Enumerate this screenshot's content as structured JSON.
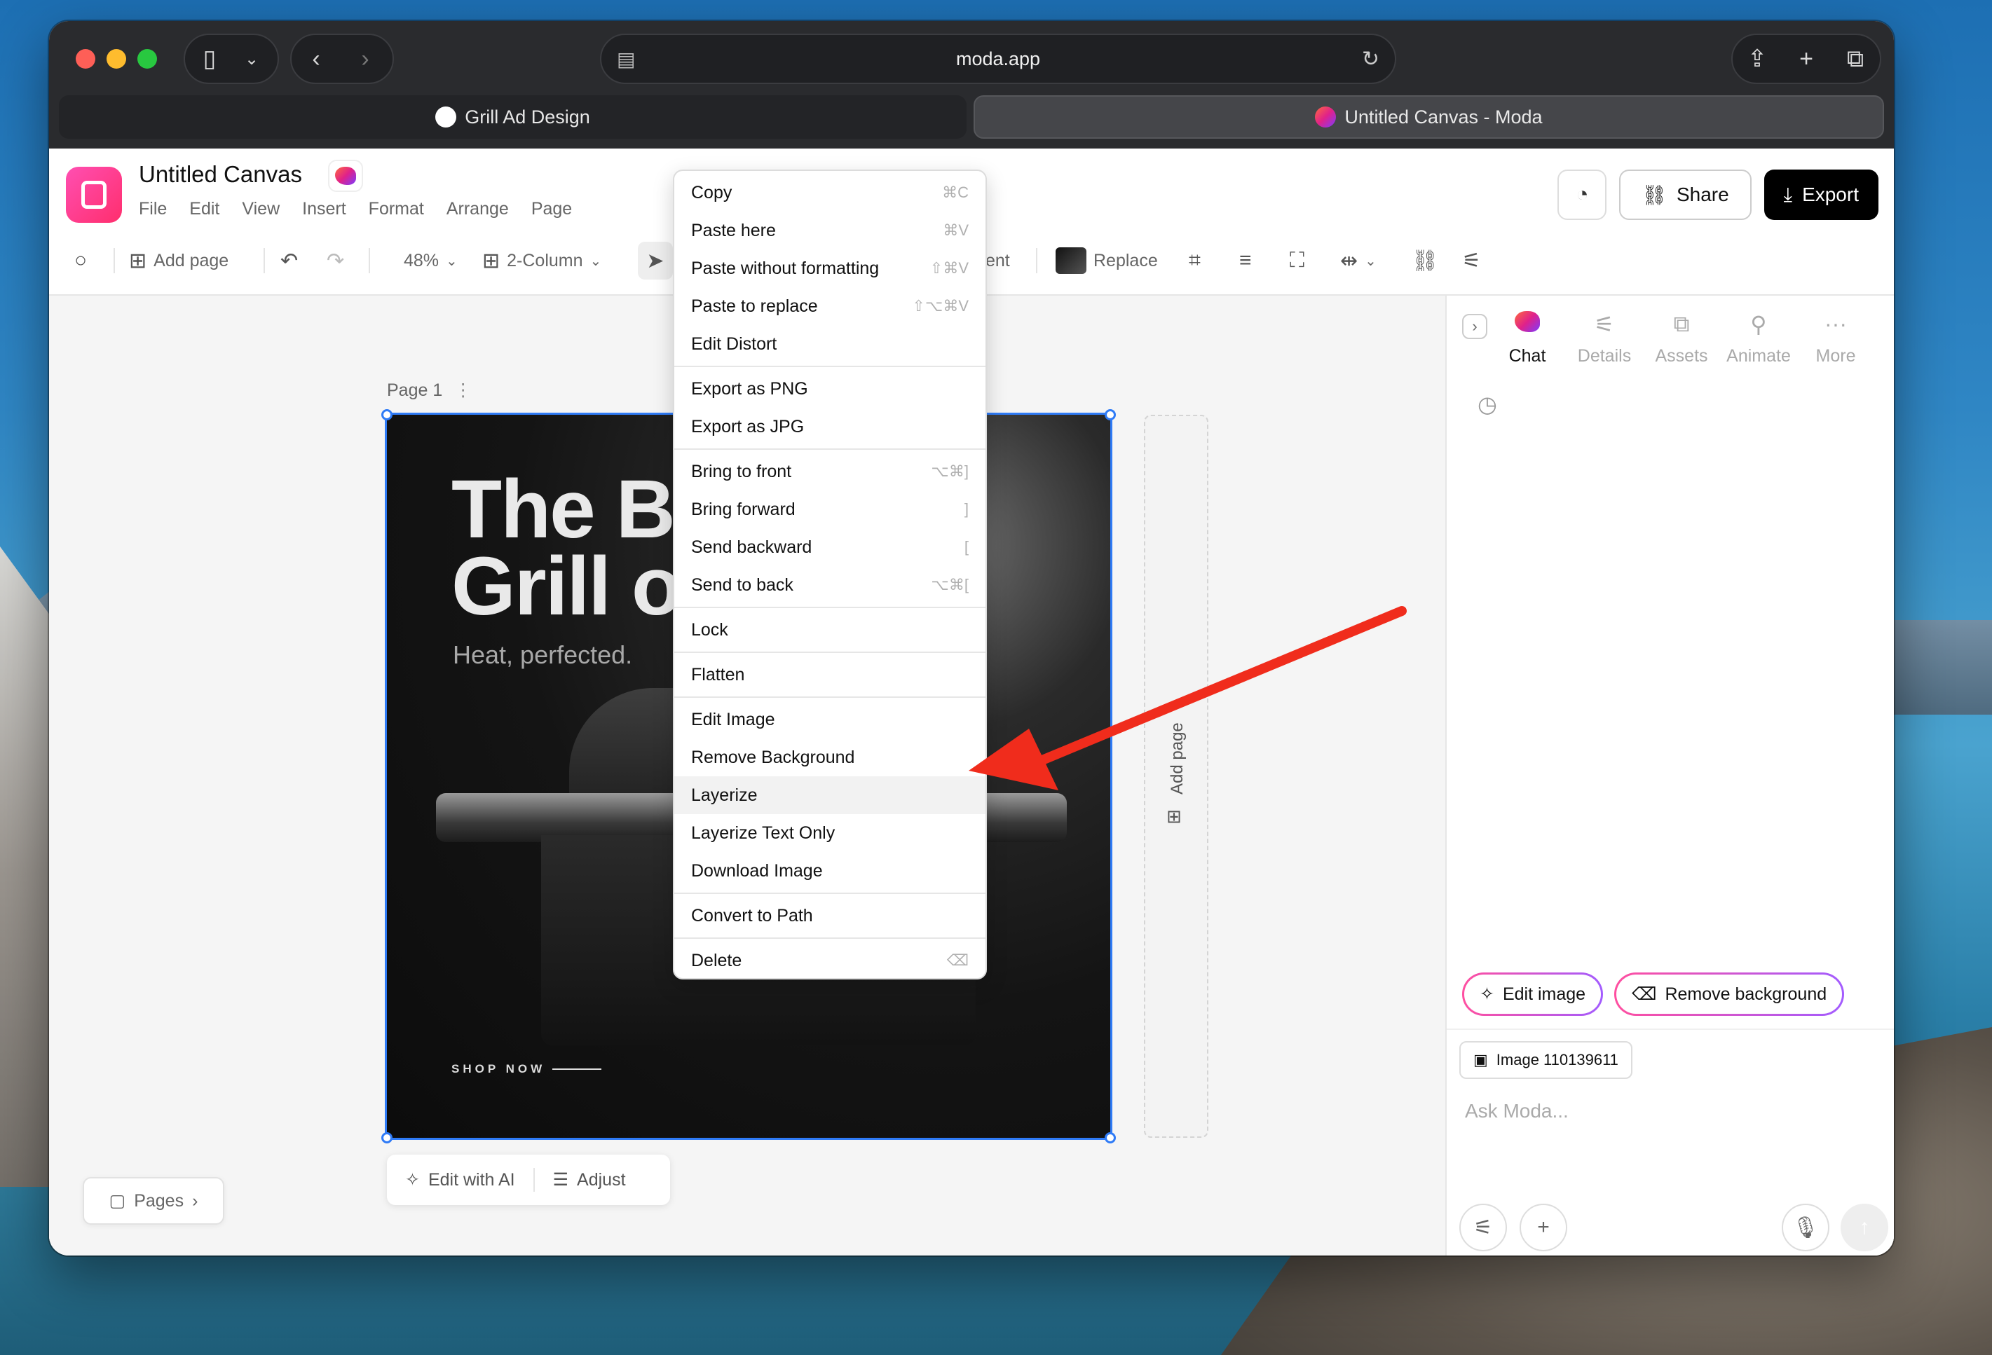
{
  "browser": {
    "url": "moda.app",
    "tabs": [
      {
        "label": "Grill Ad Design",
        "active": false
      },
      {
        "label": "Untitled Canvas - Moda",
        "active": true
      }
    ]
  },
  "app": {
    "doc_title": "Untitled Canvas",
    "menu": [
      "File",
      "Edit",
      "View",
      "Insert",
      "Format",
      "Arrange",
      "Page"
    ],
    "share_label": "Share",
    "export_label": "Export"
  },
  "toolbar": {
    "add_page": "Add page",
    "zoom": "48%",
    "layout": "2-Column",
    "partial_label": "ent",
    "replace": "Replace"
  },
  "canvas": {
    "page_label": "Page 1",
    "ad_title_line1": "The B",
    "ad_title_line2": "Grill o",
    "ad_subtitle": "Heat, perfected.",
    "ad_cta": "SHOP NOW",
    "add_page_strip": "Add page",
    "float_edit_ai": "Edit with AI",
    "float_adjust": "Adjust",
    "pages_button": "Pages"
  },
  "context_menu": [
    {
      "label": "Copy",
      "shortcut": "⌘C"
    },
    {
      "label": "Paste here",
      "shortcut": "⌘V"
    },
    {
      "label": "Paste without formatting",
      "shortcut": "⇧⌘V"
    },
    {
      "label": "Paste to replace",
      "shortcut": "⇧⌥⌘V"
    },
    {
      "label": "Edit Distort",
      "shortcut": ""
    },
    {
      "sep": true
    },
    {
      "label": "Export as PNG",
      "shortcut": ""
    },
    {
      "label": "Export as JPG",
      "shortcut": ""
    },
    {
      "sep": true
    },
    {
      "label": "Bring to front",
      "shortcut": "⌥⌘]"
    },
    {
      "label": "Bring forward",
      "shortcut": "]"
    },
    {
      "label": "Send backward",
      "shortcut": "["
    },
    {
      "label": "Send to back",
      "shortcut": "⌥⌘["
    },
    {
      "sep": true
    },
    {
      "label": "Lock",
      "shortcut": ""
    },
    {
      "sep": true
    },
    {
      "label": "Flatten",
      "shortcut": ""
    },
    {
      "sep": true
    },
    {
      "label": "Edit Image",
      "shortcut": ""
    },
    {
      "label": "Remove Background",
      "shortcut": ""
    },
    {
      "label": "Layerize",
      "shortcut": "",
      "highlighted": true
    },
    {
      "label": "Layerize Text Only",
      "shortcut": ""
    },
    {
      "label": "Download Image",
      "shortcut": ""
    },
    {
      "sep": true
    },
    {
      "label": "Convert to Path",
      "shortcut": ""
    },
    {
      "sep": true
    },
    {
      "label": "Delete",
      "shortcut": "⌫"
    }
  ],
  "panel": {
    "tabs": [
      {
        "label": "Chat",
        "icon": "chameleon-icon",
        "active": true
      },
      {
        "label": "Details",
        "icon": "sliders-icon",
        "active": false
      },
      {
        "label": "Assets",
        "icon": "image-stack-icon",
        "active": false
      },
      {
        "label": "Animate",
        "icon": "animate-icon",
        "active": false
      },
      {
        "label": "More",
        "icon": "more-icon",
        "active": false
      }
    ],
    "chip_edit": "Edit image",
    "chip_remove_bg": "Remove background",
    "attachment": "Image 110139611",
    "placeholder": "Ask Moda..."
  },
  "colors": {
    "accent_pink": "#ff2e6d",
    "selection_blue": "#2f7bf6",
    "annotation_arrow": "#f02c1c"
  }
}
